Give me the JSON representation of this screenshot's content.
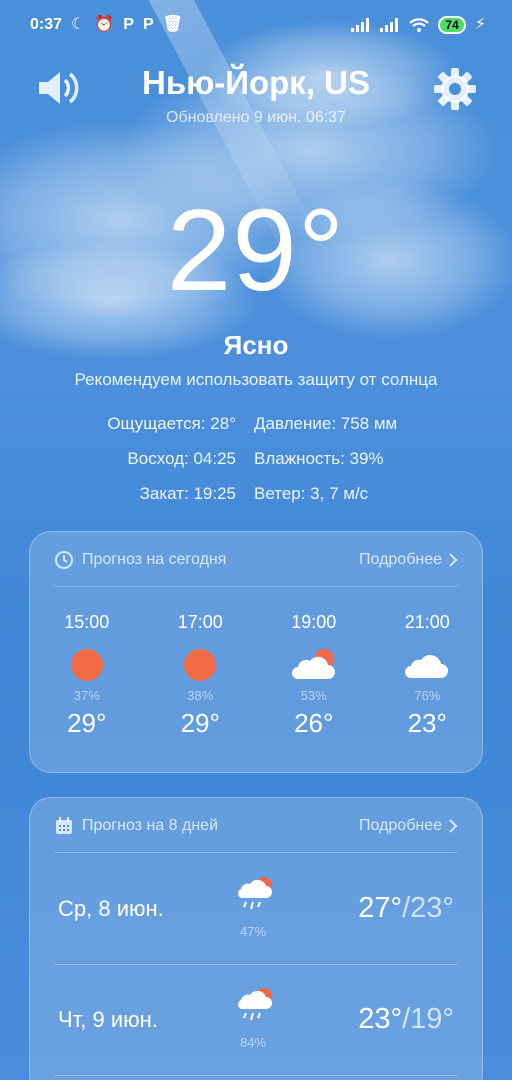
{
  "status_bar": {
    "time": "0:37",
    "battery": "74"
  },
  "header": {
    "city": "Нью-Йорк, US",
    "updated": "Обновлено 9 июн. 06:37"
  },
  "current": {
    "temperature": "29°",
    "condition": "Ясно",
    "advice": "Рекомендуем использовать защиту от солнца",
    "feels_like": "Ощущается: 28°",
    "pressure": "Давление: 758 мм",
    "sunrise": "Восход: 04:25",
    "humidity": "Влажность: 39%",
    "sunset": "Закат: 19:25",
    "wind": "Ветер: 3, 7 м/с"
  },
  "today": {
    "title": "Прогноз на сегодня",
    "more": "Подробнее",
    "hours": [
      {
        "time": "15:00",
        "icon": "sun-icon",
        "pop": "37%",
        "temp": "29°"
      },
      {
        "time": "17:00",
        "icon": "sun-icon",
        "pop": "38%",
        "temp": "29°"
      },
      {
        "time": "19:00",
        "icon": "partly-cloudy-icon",
        "pop": "53%",
        "temp": "26°"
      },
      {
        "time": "21:00",
        "icon": "cloud-icon",
        "pop": "76%",
        "temp": "23°"
      }
    ]
  },
  "daily": {
    "title": "Прогноз на 8 дней",
    "more": "Подробнее",
    "days": [
      {
        "day": "Ср, 8 июн.",
        "icon": "rain-sun-icon",
        "pop": "47%",
        "high": "27°",
        "low": "/23°"
      },
      {
        "day": "Чт, 9 июн.",
        "icon": "rain-sun-icon",
        "pop": "84%",
        "high": "23°",
        "low": "/19°"
      }
    ]
  },
  "colors": {
    "sun": "#f26a45",
    "sky_top": "#4a8fd9",
    "battery_green": "#4cd964"
  }
}
